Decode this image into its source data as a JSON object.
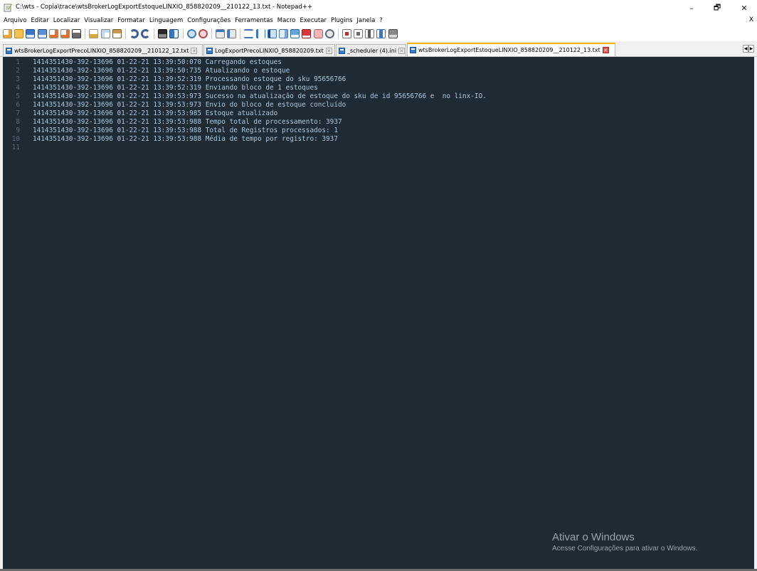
{
  "window": {
    "title": "C:\\wts - Copia\\trace\\wtsBrokerLogExportEstoqueLINXIO_858820209__210122_13.txt - Notepad++",
    "minimize": "–",
    "maximize": "🗗",
    "close": "✕"
  },
  "menu": {
    "items": [
      "Arquivo",
      "Editar",
      "Localizar",
      "Visualizar",
      "Formatar",
      "Linguagem",
      "Configurações",
      "Ferramentas",
      "Macro",
      "Executar",
      "Plugins",
      "Janela",
      "?"
    ],
    "close_doc": "X"
  },
  "toolbar": {
    "icons": [
      "new-file-icon",
      "open-file-icon",
      "save-icon",
      "save-all-icon",
      "close-icon",
      "close-all-icon",
      "print-icon",
      "cut-icon",
      "copy-icon",
      "paste-icon",
      "undo-icon",
      "redo-icon",
      "find-icon",
      "replace-icon",
      "zoom-in-icon",
      "zoom-out-icon",
      "sync-vertical-icon",
      "sync-horizontal-icon",
      "word-wrap-icon",
      "show-all-chars-icon",
      "indent-guide-icon",
      "doc-map-icon",
      "function-list-icon",
      "folder-workspace-icon",
      "monitor-icon",
      "record-macro-icon",
      "stop-macro-icon",
      "play-macro-icon",
      "run-macro-multiple-icon",
      "save-macro-icon"
    ]
  },
  "tabs": [
    {
      "label": "wtsBrokerLogExportPrecoLINXIO_858820209__210122_12.txt",
      "close": "✕",
      "active": false
    },
    {
      "label": "LogExportPrecoLINXIO_858820209.txt",
      "close": "✕",
      "active": false
    },
    {
      "label": "_scheduler (4).ini",
      "close": "✕",
      "active": false
    },
    {
      "label": "wtsBrokerLogExportEstoqueLINXIO_858820209__210122_13.txt",
      "close": "✕",
      "active": true
    }
  ],
  "tab_scroll": {
    "left": "◀",
    "right": "▶"
  },
  "editor": {
    "lines": [
      {
        "no": "1",
        "text": "1414351430-392-13696 01-22-21 13:39:50:070 Carregando estoques"
      },
      {
        "no": "2",
        "text": "1414351430-392-13696 01-22-21 13:39:50:735 Atualizando o estoque"
      },
      {
        "no": "3",
        "text": "1414351430-392-13696 01-22-21 13:39:52:319 Processando estoque do sku 95656766"
      },
      {
        "no": "4",
        "text": "1414351430-392-13696 01-22-21 13:39:52:319 Enviando bloco de 1 estoques"
      },
      {
        "no": "5",
        "text": "1414351430-392-13696 01-22-21 13:39:53:973 Sucesso na atualização de estoque do sku de id 95656766 e  no linx-IO."
      },
      {
        "no": "6",
        "text": "1414351430-392-13696 01-22-21 13:39:53:973 Envio do bloco de estoque concluído"
      },
      {
        "no": "7",
        "text": "1414351430-392-13696 01-22-21 13:39:53:985 Estoque atualizado"
      },
      {
        "no": "8",
        "text": "1414351430-392-13696 01-22-21 13:39:53:988 Tempo total de processamento: 3937"
      },
      {
        "no": "9",
        "text": "1414351430-392-13696 01-22-21 13:39:53:988 Total de Registros processados: 1"
      },
      {
        "no": "10",
        "text": "1414351430-392-13696 01-22-21 13:39:53:988 Média de tempo por registro: 3937"
      },
      {
        "no": "11",
        "text": ""
      }
    ]
  },
  "watermark": {
    "title": "Ativar o Windows",
    "subtitle": "Acesse Configurações para ativar o Windows."
  },
  "colors": {
    "editor_bg": "#1f2b33",
    "text": "#a9c8dd",
    "line_numbers": "#556b77",
    "active_tab_accent": "#fab400"
  }
}
